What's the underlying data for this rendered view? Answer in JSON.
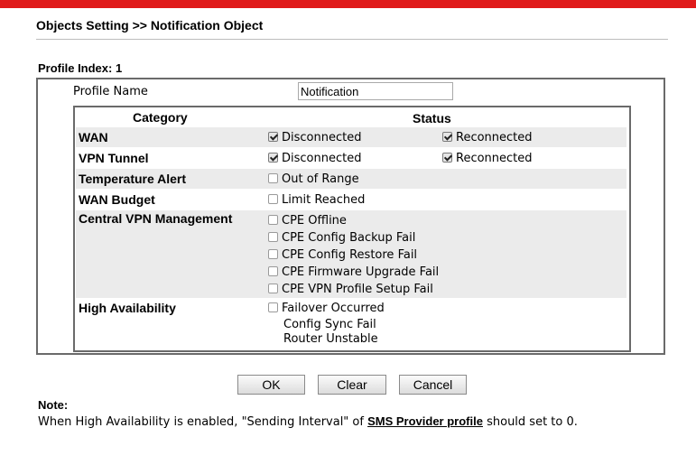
{
  "header": {
    "title": "Objects Setting >> Notification Object"
  },
  "profile": {
    "index_label": "Profile Index: 1",
    "name_label": "Profile Name",
    "name_value": "Notification"
  },
  "table": {
    "category_header": "Category",
    "status_header": "Status",
    "rows": [
      {
        "category": "WAN",
        "options": [
          {
            "label": "Disconnected",
            "checked": true
          },
          {
            "label": "Reconnected",
            "checked": true
          }
        ]
      },
      {
        "category": "VPN Tunnel",
        "options": [
          {
            "label": "Disconnected",
            "checked": true
          },
          {
            "label": "Reconnected",
            "checked": true
          }
        ]
      },
      {
        "category": "Temperature Alert",
        "options": [
          {
            "label": "Out of Range",
            "checked": false
          }
        ]
      },
      {
        "category": "WAN Budget",
        "options": [
          {
            "label": "Limit Reached",
            "checked": false
          }
        ]
      },
      {
        "category": "Central VPN Management",
        "options": [
          {
            "label": "CPE Offline",
            "checked": false
          },
          {
            "label": "CPE Config Backup Fail",
            "checked": false
          },
          {
            "label": "CPE Config Restore Fail",
            "checked": false
          },
          {
            "label": "CPE Firmware Upgrade Fail",
            "checked": false
          },
          {
            "label": "CPE VPN Profile Setup Fail",
            "checked": false
          }
        ]
      },
      {
        "category": "High Availability",
        "options": [
          {
            "label": "Failover Occurred",
            "checked": false
          }
        ],
        "text_items": [
          "Config Sync Fail",
          "Router Unstable"
        ]
      }
    ]
  },
  "buttons": {
    "ok": "OK",
    "clear": "Clear",
    "cancel": "Cancel"
  },
  "note": {
    "title": "Note:",
    "text_before": "When High Availability is enabled, \"Sending Interval\" of ",
    "link": "SMS Provider profile",
    "text_after": " should set to 0."
  }
}
